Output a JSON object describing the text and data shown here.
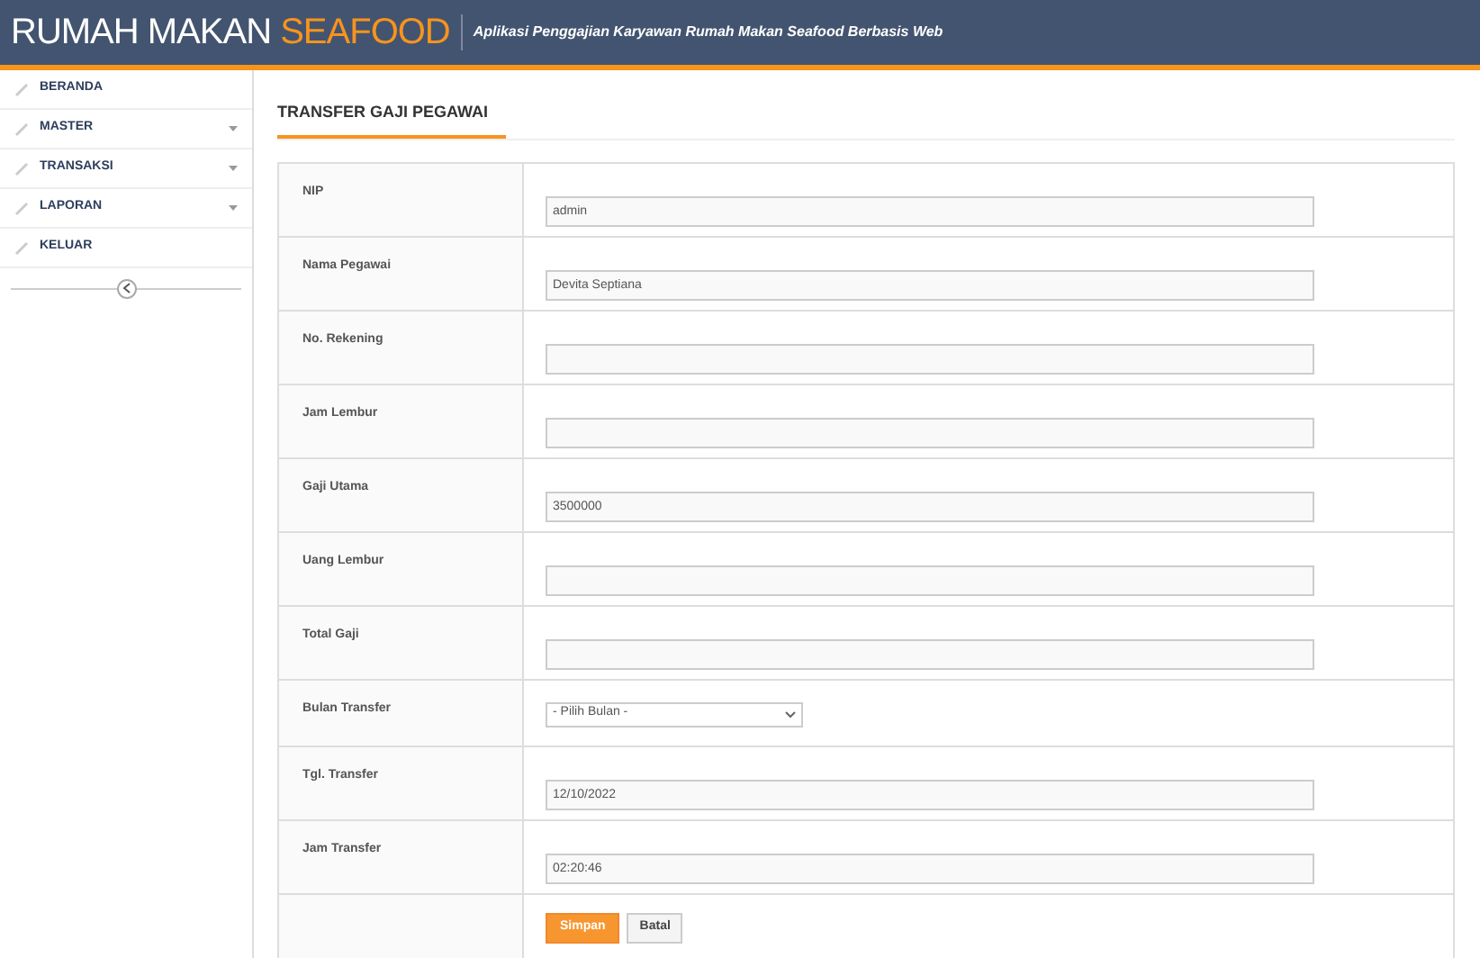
{
  "header": {
    "brand": "RUMAH MAKAN",
    "brand_accent": "SEAFOOD",
    "tagline": "Aplikasi Penggajian Karyawan Rumah Makan Seafood Berbasis Web"
  },
  "sidebar": {
    "items": [
      {
        "label": "BERANDA",
        "has_submenu": false
      },
      {
        "label": "MASTER",
        "has_submenu": true
      },
      {
        "label": "TRANSAKSI",
        "has_submenu": true
      },
      {
        "label": "LAPORAN",
        "has_submenu": true
      },
      {
        "label": "KELUAR",
        "has_submenu": false
      }
    ]
  },
  "page_title": "TRANSFER GAJI PEGAWAI",
  "form": {
    "fields": [
      {
        "label": "NIP",
        "kind": "text",
        "value": "admin"
      },
      {
        "label": "Nama Pegawai",
        "kind": "text",
        "value": "Devita Septiana"
      },
      {
        "label": "No. Rekening",
        "kind": "text"
      },
      {
        "label": "Jam Lembur",
        "kind": "text"
      },
      {
        "label": "Gaji Utama",
        "kind": "text",
        "value": "3500000"
      },
      {
        "label": "Uang Lembur",
        "kind": "text"
      },
      {
        "label": "Total Gaji",
        "kind": "text"
      },
      {
        "label": "Bulan Transfer",
        "kind": "select",
        "value": "- Pilih Bulan -"
      },
      {
        "label": "Tgl. Transfer",
        "kind": "text",
        "value": "12/10/2022"
      },
      {
        "label": "Jam Transfer",
        "kind": "text",
        "value": "02:20:46"
      }
    ],
    "buttons": [
      {
        "label": "Simpan",
        "kind": "primary"
      },
      {
        "label": "Batal",
        "kind": "default"
      }
    ]
  }
}
